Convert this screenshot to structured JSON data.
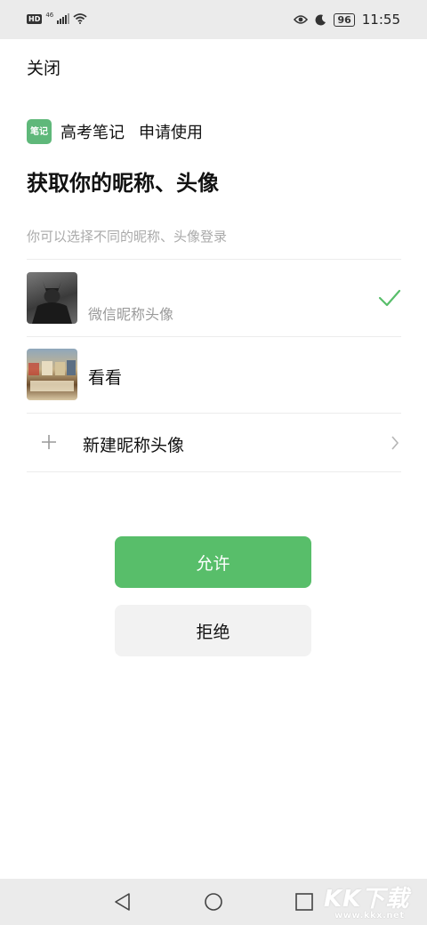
{
  "status_bar": {
    "hd": "HD",
    "network": "46",
    "battery": "96",
    "time": "11:55"
  },
  "header": {
    "close_label": "关闭"
  },
  "app": {
    "logo_text": "笔记",
    "name": "高考笔记",
    "request": "申请使用"
  },
  "main": {
    "title": "获取你的昵称、头像",
    "subtitle": "你可以选择不同的昵称、头像登录",
    "options": [
      {
        "label": "微信昵称头像",
        "selected": true
      },
      {
        "label": "看看",
        "selected": false
      }
    ],
    "new_option_label": "新建昵称头像"
  },
  "actions": {
    "allow_label": "允许",
    "deny_label": "拒绝",
    "allow_color": "#58be6a"
  },
  "watermark": {
    "text": "KK下载",
    "url": "www.kkx.net"
  }
}
